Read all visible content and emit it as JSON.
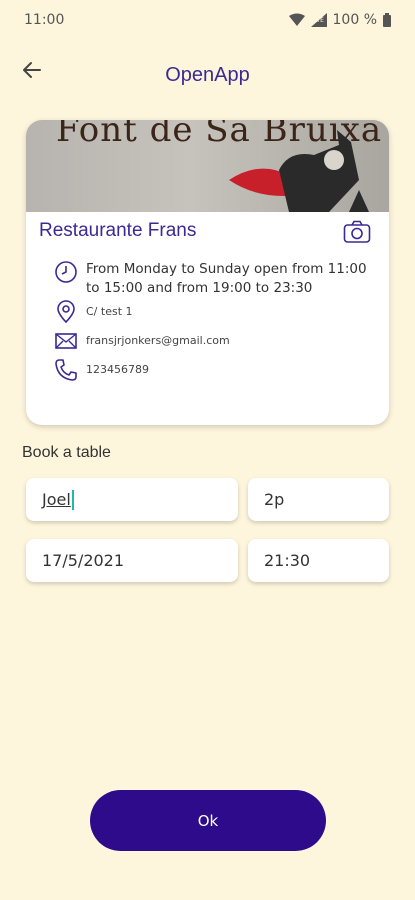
{
  "status_bar": {
    "time": "11:00",
    "battery": "100 %"
  },
  "app_bar": {
    "title": "OpenApp"
  },
  "restaurant": {
    "sign_text": "Font de Sa Bruixa",
    "name": "Restaurante Frans",
    "hours": "From Monday to Sunday open from 11:00 to 15:00 and from 19:00 to 23:30",
    "address": "C/ test 1",
    "email": "fransjrjonkers@gmail.com",
    "phone": "123456789"
  },
  "booking": {
    "section_label": "Book a table",
    "name_value": "Joel",
    "people_value": "2p",
    "date_value": "17/5/2021",
    "time_value": "21:30"
  },
  "ok_button": {
    "label": "Ok"
  },
  "colors": {
    "accent": "#3a2a93",
    "button": "#2d0b8a",
    "background": "#fdf5dc"
  }
}
